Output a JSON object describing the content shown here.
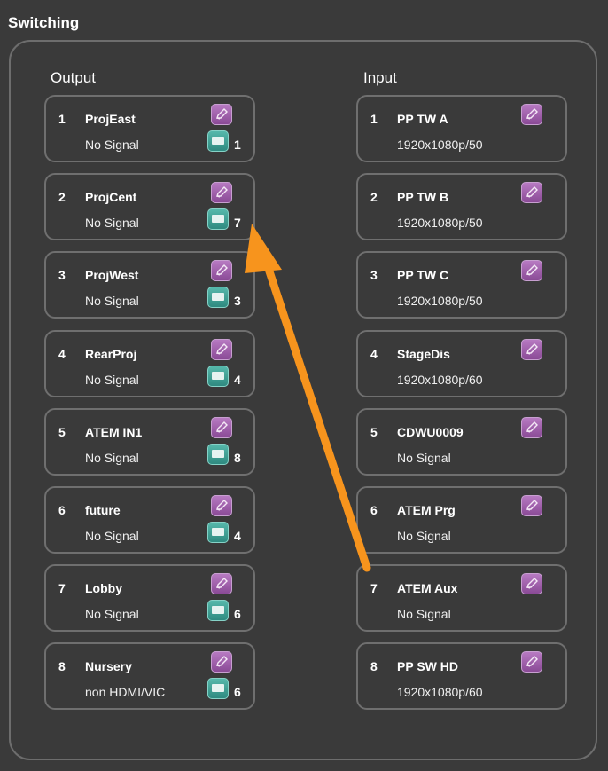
{
  "title": "Switching",
  "output_header": "Output",
  "input_header": "Input",
  "outputs": [
    {
      "num": "1",
      "name": "ProjEast",
      "status": "No Signal",
      "routed": "1"
    },
    {
      "num": "2",
      "name": "ProjCent",
      "status": "No Signal",
      "routed": "7"
    },
    {
      "num": "3",
      "name": "ProjWest",
      "status": "No Signal",
      "routed": "3"
    },
    {
      "num": "4",
      "name": "RearProj",
      "status": "No Signal",
      "routed": "4"
    },
    {
      "num": "5",
      "name": "ATEM IN1",
      "status": "No Signal",
      "routed": "8"
    },
    {
      "num": "6",
      "name": "future",
      "status": "No Signal",
      "routed": "4"
    },
    {
      "num": "7",
      "name": "Lobby",
      "status": "No Signal",
      "routed": "6"
    },
    {
      "num": "8",
      "name": "Nursery",
      "status": "non HDMI/VIC",
      "routed": "6"
    }
  ],
  "inputs": [
    {
      "num": "1",
      "name": "PP TW A",
      "status": "1920x1080p/50"
    },
    {
      "num": "2",
      "name": "PP TW B",
      "status": "1920x1080p/50"
    },
    {
      "num": "3",
      "name": "PP TW C",
      "status": "1920x1080p/50"
    },
    {
      "num": "4",
      "name": "StageDis",
      "status": "1920x1080p/60"
    },
    {
      "num": "5",
      "name": "CDWU0009",
      "status": "No Signal"
    },
    {
      "num": "6",
      "name": "ATEM Prg",
      "status": "No Signal"
    },
    {
      "num": "7",
      "name": "ATEM Aux",
      "status": "No Signal"
    },
    {
      "num": "8",
      "name": "PP SW HD",
      "status": "1920x1080p/60"
    }
  ],
  "colors": {
    "background": "#3a3a3a",
    "edit_button": "#9a5aa6",
    "screen_icon": "#3f9e92",
    "annotation_arrow": "#f7941d"
  },
  "icons": {
    "edit": "pencil-icon",
    "display": "monitor-icon"
  }
}
